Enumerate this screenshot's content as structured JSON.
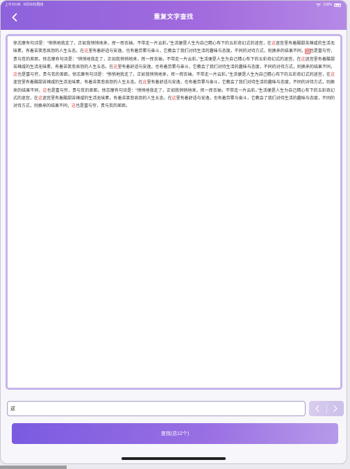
{
  "status_bar": {
    "time": "上午10:06",
    "date": "6月26日周四",
    "battery": "100%"
  },
  "header": {
    "title": "重复文字查找"
  },
  "content": {
    "segments": [
      {
        "t": "徐志摩有句诗是：“悄悄地我走了，正如我悄悄地来，挥一挥衣袖，不带走一片云彩。”生活便是人生为自己精心布下的五彩奇幻式的迷宫，在"
      },
      {
        "t": "这",
        "hl": true
      },
      {
        "t": "迷宫里有着酸甜苦辣咸的生活无味素，有着苦笑悲哀怨的人生五态。在"
      },
      {
        "t": "这",
        "hl": true
      },
      {
        "t": "里有着舒适与安逸，也有着劳累与奋斗，它教会了我们对待生活的趣味与态度。不同的对待方式，则换来的结果不同，"
      },
      {
        "t": "这",
        "hl": true,
        "current": true
      },
      {
        "t": "也是富与穷，贵与贫的差距。徐志摩有句诗是：“悄悄地我走了，正如我悄悄地来，挥一挥衣袖，不带走一片云彩。”生活便是人生为自己精心布下的五彩奇幻式的迷宫，在"
      },
      {
        "t": "这",
        "hl": true
      },
      {
        "t": "迷宫里有着酸甜苦辣咸的生活无味素，有着苦笑悲哀怨的人生五态。在"
      },
      {
        "t": "这",
        "hl": true
      },
      {
        "t": "里有着舒适与安逸，也有着劳累与奋斗，它教会了我们对待生活的趣味与态度，不同的对待方式，则换来的结果不同，"
      },
      {
        "t": "这",
        "hl": true
      },
      {
        "t": "也是富与穷，贵与贫的差距。徐志摩有句诗是：“悄悄地我走了，正如我悄悄地来，挥一挥衣袖，不带走一片云彩。”生活便是人生为自己精心布下的五彩奇幻式的迷宫，在"
      },
      {
        "t": "这",
        "hl": true
      },
      {
        "t": "迷宫里有着酸甜苦辣咸的生活无味素，有着苦笑悲哀怨的人生五态。在"
      },
      {
        "t": "这",
        "hl": true
      },
      {
        "t": "里有着舒适与安逸，也有着劳累与奋斗，它教会了我们对待生活的趣味与态度，不同的对待方式，则换来的结果不同，"
      },
      {
        "t": "这",
        "hl": true
      },
      {
        "t": "也是富与穷，贵与贫的差距。徐志摩有句诗是：“悄悄地我走了，正如我悄悄地来，挥一挥衣袖，不带走一片云彩。”生活便是人生为自己精心布下的五彩奇幻式的迷宫，在"
      },
      {
        "t": "这",
        "hl": true
      },
      {
        "t": "迷宫里有着酸甜苦辣咸的生活无味素，有着苦笑悲哀怨的人生五态。在"
      },
      {
        "t": "这",
        "hl": true
      },
      {
        "t": "里有着舒适与安逸，也有着劳累与奋斗，它教会了我们对待生活的趣味与态度，不同的对待方式，则换来的结果不同，"
      },
      {
        "t": "这",
        "hl": true
      },
      {
        "t": "也是富与穷，贵与贫的差距。"
      }
    ]
  },
  "search": {
    "value": "这",
    "placeholder": ""
  },
  "find_button": {
    "label": "查找(总12个)"
  },
  "colors": {
    "accent": "#8d62dc",
    "highlight": "#e83a3a"
  }
}
